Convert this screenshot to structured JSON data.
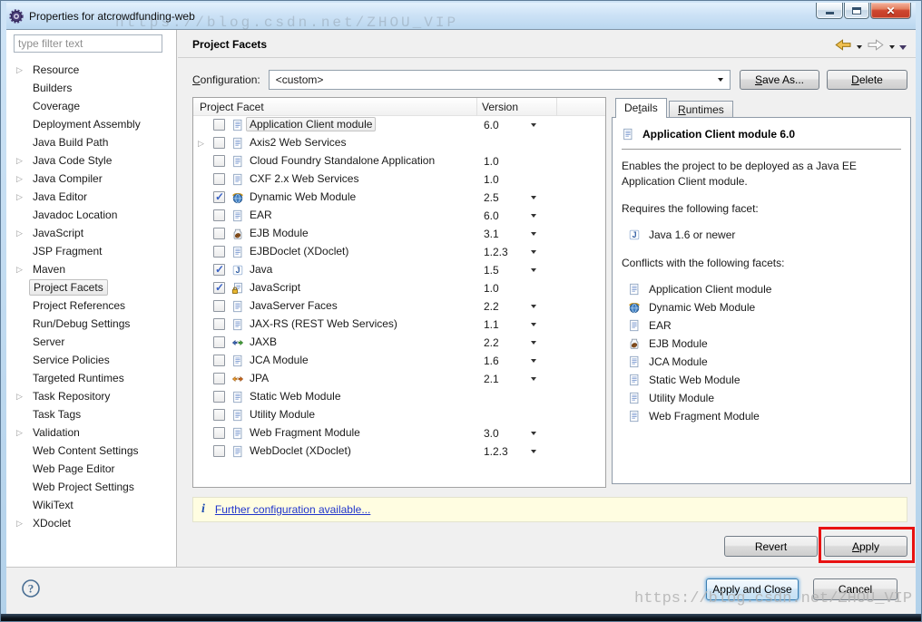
{
  "window": {
    "title": "Properties for atcrowdfunding-web"
  },
  "sidebar": {
    "filter_placeholder": "type filter text",
    "items": [
      {
        "label": "Resource",
        "expandable": true
      },
      {
        "label": "Builders"
      },
      {
        "label": "Coverage"
      },
      {
        "label": "Deployment Assembly"
      },
      {
        "label": "Java Build Path"
      },
      {
        "label": "Java Code Style",
        "expandable": true
      },
      {
        "label": "Java Compiler",
        "expandable": true
      },
      {
        "label": "Java Editor",
        "expandable": true
      },
      {
        "label": "Javadoc Location"
      },
      {
        "label": "JavaScript",
        "expandable": true
      },
      {
        "label": "JSP Fragment"
      },
      {
        "label": "Maven",
        "expandable": true
      },
      {
        "label": "Project Facets",
        "selected": true
      },
      {
        "label": "Project References"
      },
      {
        "label": "Run/Debug Settings"
      },
      {
        "label": "Server"
      },
      {
        "label": "Service Policies"
      },
      {
        "label": "Targeted Runtimes"
      },
      {
        "label": "Task Repository",
        "expandable": true
      },
      {
        "label": "Task Tags"
      },
      {
        "label": "Validation",
        "expandable": true
      },
      {
        "label": "Web Content Settings"
      },
      {
        "label": "Web Page Editor"
      },
      {
        "label": "Web Project Settings"
      },
      {
        "label": "WikiText"
      },
      {
        "label": "XDoclet",
        "expandable": true
      }
    ]
  },
  "header": {
    "title": "Project Facets"
  },
  "config": {
    "label": "Configuration:",
    "mnemonic": "C",
    "value": "<custom>",
    "save_as": "Save As...",
    "save_as_mnemonic": "S",
    "delete": "Delete",
    "delete_mnemonic": "D"
  },
  "facets": {
    "columns": [
      "Project Facet",
      "Version"
    ],
    "rows": [
      {
        "checked": false,
        "icon": "facet-file-icon",
        "name": "Application Client module",
        "version": "6.0",
        "dropdown": true,
        "selected": true
      },
      {
        "checked": false,
        "icon": "facet-file-icon",
        "name": "Axis2 Web Services",
        "version": "",
        "expandable": true
      },
      {
        "checked": false,
        "icon": "facet-file-icon",
        "name": "Cloud Foundry Standalone Application",
        "version": "1.0"
      },
      {
        "checked": false,
        "icon": "facet-file-icon",
        "name": "CXF 2.x Web Services",
        "version": "1.0"
      },
      {
        "checked": true,
        "icon": "web-module-icon",
        "name": "Dynamic Web Module",
        "version": "2.5",
        "dropdown": true
      },
      {
        "checked": false,
        "icon": "facet-file-icon",
        "name": "EAR",
        "version": "6.0",
        "dropdown": true
      },
      {
        "checked": false,
        "icon": "ejb-icon",
        "name": "EJB Module",
        "version": "3.1",
        "dropdown": true
      },
      {
        "checked": false,
        "icon": "facet-file-icon",
        "name": "EJBDoclet (XDoclet)",
        "version": "1.2.3",
        "dropdown": true
      },
      {
        "checked": true,
        "icon": "java-icon",
        "name": "Java",
        "version": "1.5",
        "dropdown": true
      },
      {
        "checked": true,
        "icon": "javascript-icon",
        "name": "JavaScript",
        "version": "1.0"
      },
      {
        "checked": false,
        "icon": "facet-file-icon",
        "name": "JavaServer Faces",
        "version": "2.2",
        "dropdown": true
      },
      {
        "checked": false,
        "icon": "facet-file-icon",
        "name": "JAX-RS (REST Web Services)",
        "version": "1.1",
        "dropdown": true
      },
      {
        "checked": false,
        "icon": "jaxb-icon",
        "name": "JAXB",
        "version": "2.2",
        "dropdown": true
      },
      {
        "checked": false,
        "icon": "facet-file-icon",
        "name": "JCA Module",
        "version": "1.6",
        "dropdown": true
      },
      {
        "checked": false,
        "icon": "jpa-icon",
        "name": "JPA",
        "version": "2.1",
        "dropdown": true
      },
      {
        "checked": false,
        "icon": "facet-file-icon",
        "name": "Static Web Module",
        "version": ""
      },
      {
        "checked": false,
        "icon": "facet-file-icon",
        "name": "Utility Module",
        "version": ""
      },
      {
        "checked": false,
        "icon": "facet-file-icon",
        "name": "Web Fragment Module",
        "version": "3.0",
        "dropdown": true
      },
      {
        "checked": false,
        "icon": "facet-file-icon",
        "name": "WebDoclet (XDoclet)",
        "version": "1.2.3",
        "dropdown": true
      }
    ]
  },
  "details": {
    "tabs": [
      {
        "label": "Details",
        "mnemonic": "t",
        "active": true
      },
      {
        "label": "Runtimes",
        "mnemonic": "R"
      }
    ],
    "title": "Application Client module 6.0",
    "description": "Enables the project to be deployed as a Java EE Application Client module.",
    "requires_heading": "Requires the following facet:",
    "requires": [
      {
        "icon": "java-icon",
        "label": "Java 1.6 or newer"
      }
    ],
    "conflicts_heading": "Conflicts with the following facets:",
    "conflicts": [
      {
        "icon": "facet-file-icon",
        "label": "Application Client module"
      },
      {
        "icon": "web-module-icon",
        "label": "Dynamic Web Module"
      },
      {
        "icon": "facet-file-icon",
        "label": "EAR"
      },
      {
        "icon": "ejb-icon",
        "label": "EJB Module"
      },
      {
        "icon": "facet-file-icon",
        "label": "JCA Module"
      },
      {
        "icon": "facet-file-icon",
        "label": "Static Web Module"
      },
      {
        "icon": "facet-file-icon",
        "label": "Utility Module"
      },
      {
        "icon": "facet-file-icon",
        "label": "Web Fragment Module"
      }
    ]
  },
  "info_bar": {
    "icon_text": "i",
    "link": "Further configuration available..."
  },
  "actions": {
    "revert": "Revert",
    "apply": "Apply",
    "apply_mnemonic": "A",
    "apply_and_close": "Apply and Close",
    "cancel": "Cancel"
  },
  "annotation": {
    "color": "#e81212"
  },
  "watermark": {
    "text": "https://blog.csdn.net/ZHOU_VIP"
  }
}
